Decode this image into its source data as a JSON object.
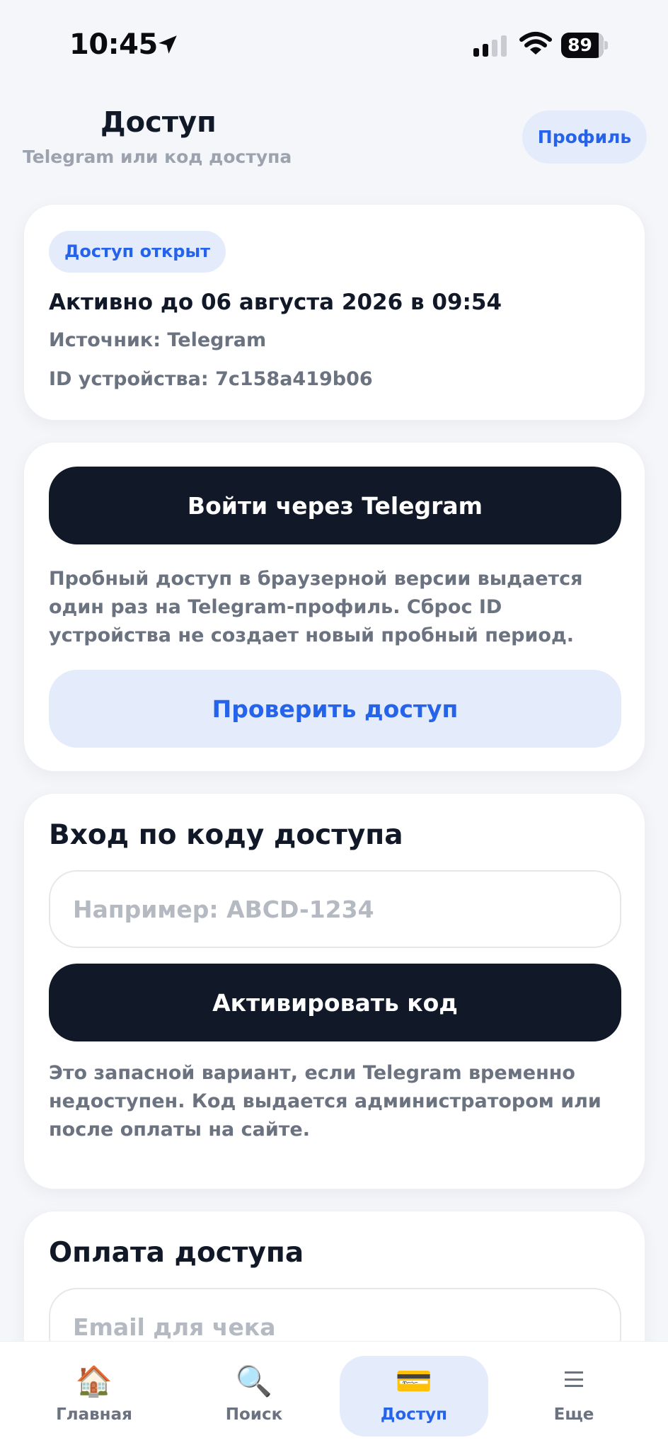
{
  "status_bar": {
    "time": "10:45",
    "battery_level": "89",
    "location_icon": "location-arrow-icon",
    "signal_icon": "cellular-signal-icon",
    "wifi_icon": "wifi-icon"
  },
  "header": {
    "title": "Доступ",
    "subtitle": "Telegram или код доступа",
    "profile_button": "Профиль"
  },
  "access_status": {
    "badge": "Доступ открыт",
    "active_until": "Активно до 06 августа 2026 в 09:54",
    "source": "Источник: Telegram",
    "device_id": "ID устройства: 7c158a419b06"
  },
  "telegram_login": {
    "login_button": "Войти через Telegram",
    "note": "Пробный доступ в браузерной версии выдается один раз на Telegram-профиль. Сброс ID устройства не создает новый пробный период.",
    "check_button": "Проверить доступ"
  },
  "code_login": {
    "title": "Вход по коду доступа",
    "input_value": "",
    "input_placeholder": "Например: ABCD-1234",
    "activate_button": "Активировать код",
    "note": "Это запасной вариант, если Telegram временно недоступен. Код выдается администратором или после оплаты на сайте."
  },
  "payment": {
    "title": "Оплата доступа",
    "email_value": "",
    "email_placeholder": "Email для чека"
  },
  "tab_bar": {
    "active": "Доступ",
    "tabs": [
      {
        "label": "Главная",
        "icon": "🏠"
      },
      {
        "label": "Поиск",
        "icon": "🔍"
      },
      {
        "label": "Доступ",
        "icon": "💳"
      },
      {
        "label": "Еще",
        "icon": "menu-icon"
      }
    ]
  },
  "colors": {
    "accent": "#2563eb",
    "accent_bg": "#e4ebfb",
    "dark_button": "#111827",
    "muted_text": "#6b7280",
    "background": "#f4f6fa"
  }
}
